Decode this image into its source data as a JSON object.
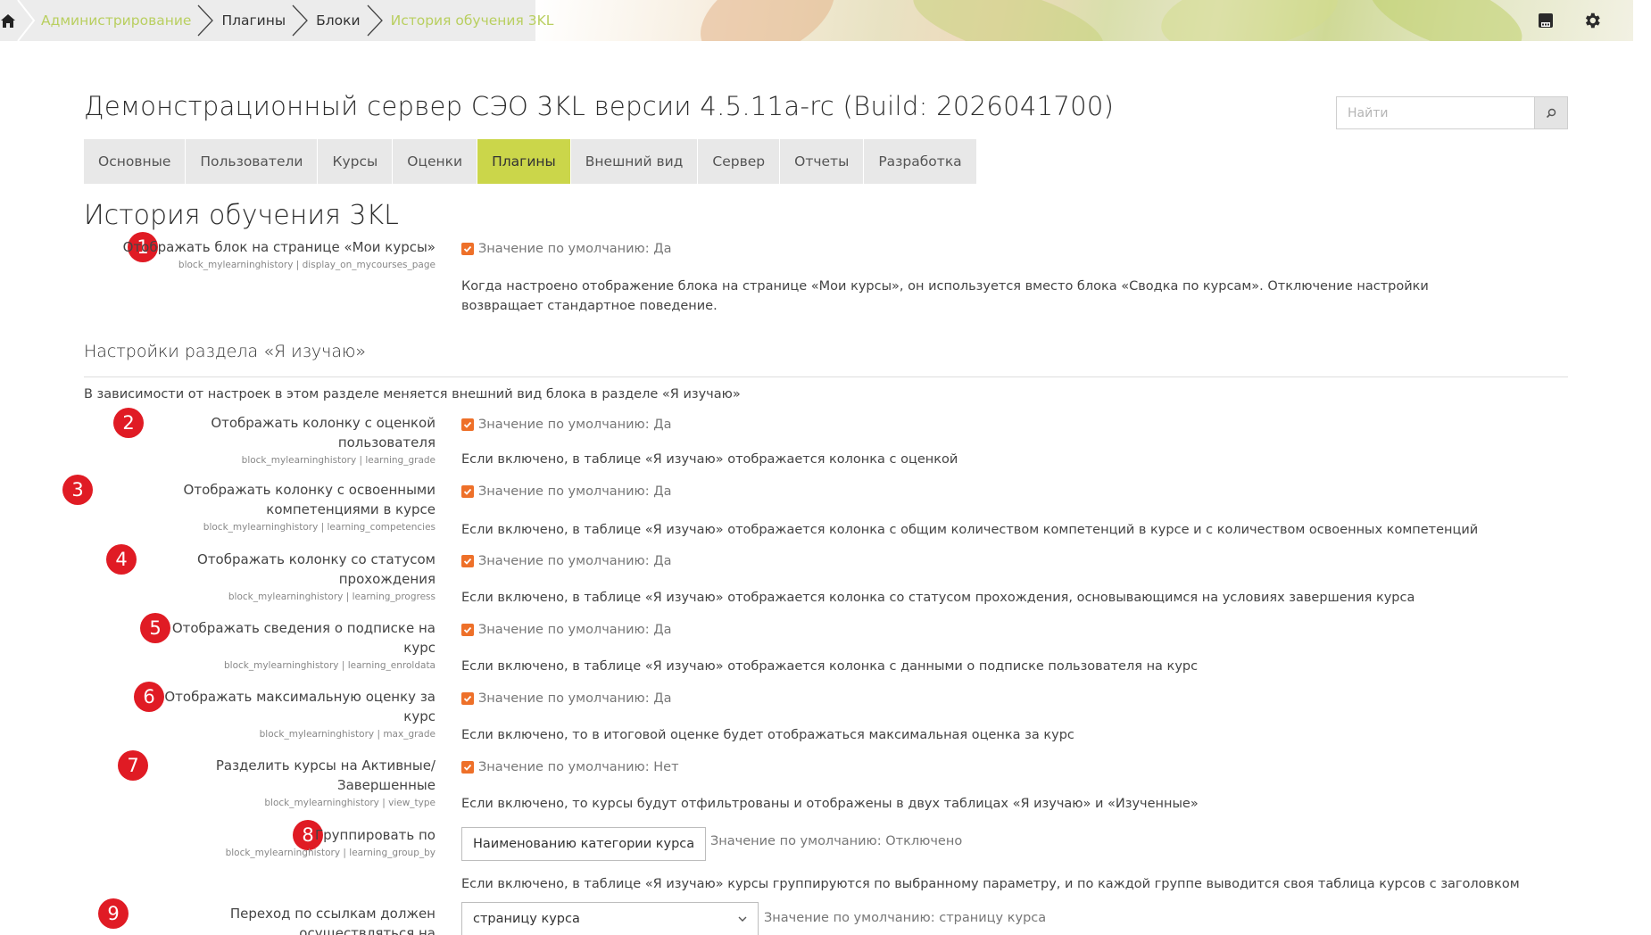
{
  "breadcrumbs": [
    {
      "label": "Администрирование"
    },
    {
      "label": "Плагины"
    },
    {
      "label": "Блоки"
    },
    {
      "label": "История обучения 3KL"
    }
  ],
  "site": {
    "title": "Демонстрационный сервер СЭО 3KL версии 4.5.11a-rc (Build: 2026041700)"
  },
  "search": {
    "placeholder": "Найти"
  },
  "tabs": [
    "Основные",
    "Пользователи",
    "Курсы",
    "Оценки",
    "Плагины",
    "Внешний вид",
    "Сервер",
    "Отчеты",
    "Разработка"
  ],
  "active_tab": "Плагины",
  "page": {
    "heading": "История обучения 3KL"
  },
  "section": {
    "heading": "Настройки раздела «Я изучаю»",
    "description": "В зависимости от настроек в этом разделе меняется внешний вид блока в разделе «Я изучаю»"
  },
  "settings": [
    {
      "num": "1",
      "label": "Отображать блок на странице «Мои курсы»",
      "key": "block_mylearninghistory | display_on_mycourses_page",
      "default": "Значение по умолчанию: Да",
      "desc": "Когда настроено отображение блока на странице «Мои курсы», он используется вместо блока «Сводка по курсам». Отключение настройки возвращает стандартное поведение."
    },
    {
      "num": "2",
      "label": "Отображать колонку с оценкой пользователя",
      "key": "block_mylearninghistory | learning_grade",
      "default": "Значение по умолчанию: Да",
      "desc": "Если включено, в таблице «Я изучаю» отображается колонка с оценкой"
    },
    {
      "num": "3",
      "label": "Отображать колонку с освоенными компетенциями в курсе",
      "key": "block_mylearninghistory | learning_competencies",
      "default": "Значение по умолчанию: Да",
      "desc": "Если включено, в таблице «Я изучаю» отображается колонка с общим количеством компетенций в курсе и с количеством освоенных компетенций"
    },
    {
      "num": "4",
      "label": "Отображать колонку со статусом прохождения",
      "key": "block_mylearninghistory | learning_progress",
      "default": "Значение по умолчанию: Да",
      "desc": "Если включено, в таблице «Я изучаю» отображается колонка со статусом прохождения, основывающимся на условиях завершения курса"
    },
    {
      "num": "5",
      "label": "Отображать сведения о подписке на курс",
      "key": "block_mylearninghistory | learning_enroldata",
      "default": "Значение по умолчанию: Да",
      "desc": "Если включено, в таблице «Я изучаю» отображается колонка с данными о подписке пользователя на курс"
    },
    {
      "num": "6",
      "label": "Отображать максимальную оценку за курс",
      "key": "block_mylearninghistory | max_grade",
      "default": "Значение по умолчанию: Да",
      "desc": "Если включено, то в итоговой оценке будет отображаться максимальная оценка за курс"
    },
    {
      "num": "7",
      "label": "Разделить курсы на Активные/Завершенные",
      "key": "block_mylearninghistory | view_type",
      "default": "Значение по умолчанию: Нет",
      "desc": "Если включено, то курсы будут отфильтрованы и отображены в двух таблицах «Я изучаю» и «Изученные»"
    },
    {
      "num": "8",
      "label": "Группировать по",
      "key": "block_mylearninghistory | learning_group_by",
      "select_value": "Наименованию категории курса",
      "default": "Значение по умолчанию: Отключено",
      "desc": "Если включено, в таблице «Я изучаю» курсы группируются по выбранному параметру, и по каждой группе выводится своя таблица курсов с заголовком"
    },
    {
      "num": "9",
      "label": "Переход по ссылкам должен осуществляться на",
      "key": "block_mylearninghistory | learning_course_link_url",
      "select_value": "страницу курса",
      "default": "Значение по умолчанию: страницу курса"
    }
  ],
  "colors": {
    "accent_tab": "#cbd64a",
    "badge": "#e01b24",
    "checkbox": "#ee7029",
    "breadcrumb_muted": "#b9cf60"
  },
  "icons": {
    "home": "home-icon",
    "save": "save-icon",
    "settings": "gear-icon",
    "search": "search-icon"
  }
}
